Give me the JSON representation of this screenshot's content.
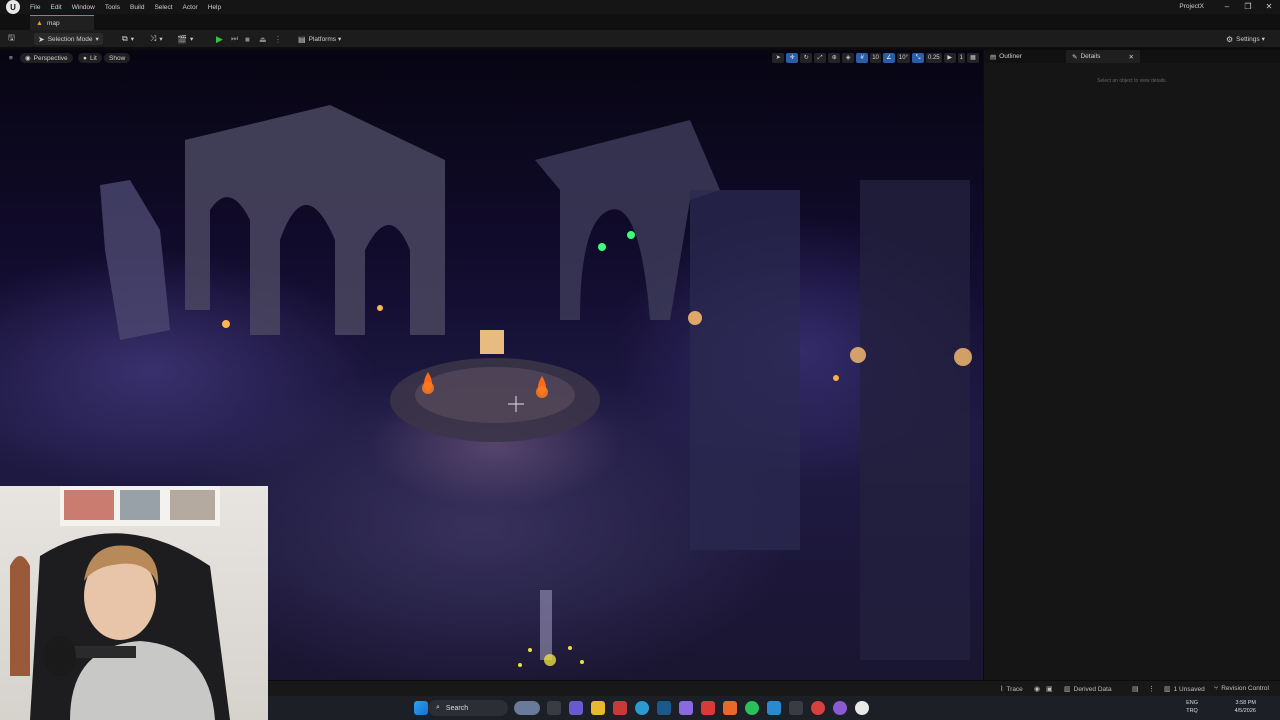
{
  "menu": {
    "logo": "U",
    "items": [
      "File",
      "Edit",
      "Window",
      "Tools",
      "Build",
      "Select",
      "Actor",
      "Help"
    ],
    "project_name": "ProjectX",
    "window_controls": [
      "–",
      "❐",
      "✕"
    ]
  },
  "tabs": {
    "level_tab": "map"
  },
  "toolbar": {
    "selection_mode": "Selection Mode",
    "platforms": "Platforms",
    "settings": "Settings"
  },
  "viewport": {
    "perspective_label": "Perspective",
    "lit_label": "Lit",
    "show_label": "Show",
    "grid_snap_value": "10",
    "rotation_snap_value": "10°",
    "scale_snap_value": "0.25",
    "camera_speed_value": "1"
  },
  "panels": {
    "outliner_tab": "Outliner",
    "details_tab": "Details",
    "details_hint": "Select an object to view details."
  },
  "statusbar": {
    "trace": "Trace",
    "derived_data": "Derived Data",
    "unsaved": "1 Unsaved",
    "revision_control": "Revision Control"
  },
  "taskbar": {
    "search_placeholder": "Search",
    "lang_line1": "ENG",
    "lang_line2": "TRQ",
    "time": "3:58 PM",
    "date": "4/5/2026"
  },
  "colors": {
    "accent_blue": "#2b5ea8",
    "play_green": "#3ac23a",
    "tab_orange": "#e0a030"
  }
}
